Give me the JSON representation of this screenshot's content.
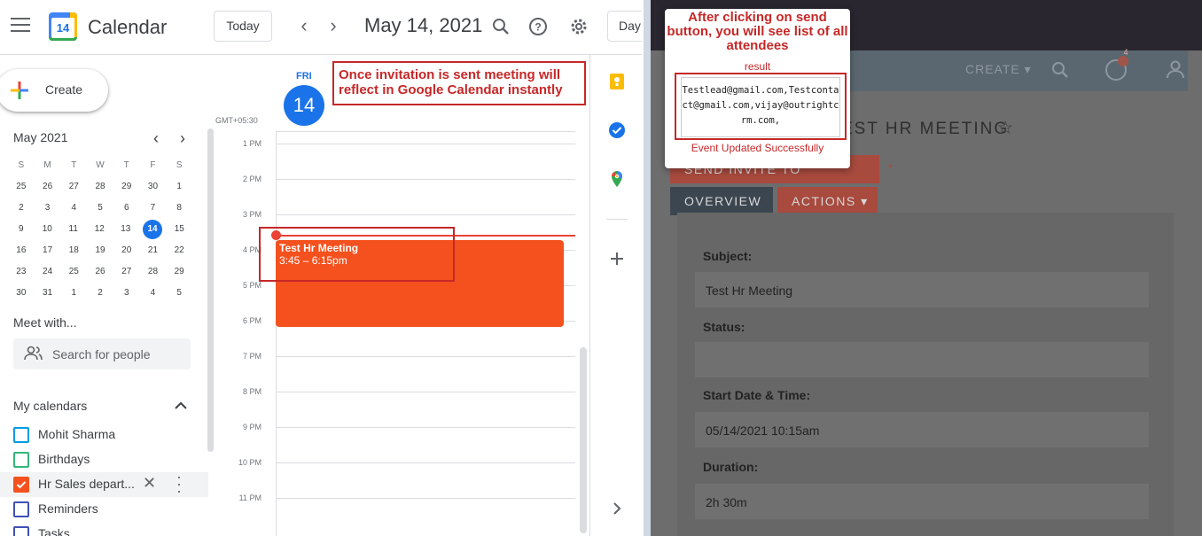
{
  "app": {
    "title": "Calendar",
    "logo_day": "14"
  },
  "toolbar": {
    "today_label": "Today",
    "prev": "‹",
    "next": "›",
    "date_title": "May 14, 2021",
    "view_label": "Day",
    "icons": [
      "search-icon",
      "help-icon",
      "gear-icon"
    ]
  },
  "create": {
    "label": "Create"
  },
  "minical": {
    "title": "May 2021",
    "prev": "‹",
    "next": "›",
    "weekdays": [
      "S",
      "M",
      "T",
      "W",
      "T",
      "F",
      "S"
    ],
    "weeks": [
      [
        "25",
        "26",
        "27",
        "28",
        "29",
        "30",
        "1"
      ],
      [
        "2",
        "3",
        "4",
        "5",
        "6",
        "7",
        "8"
      ],
      [
        "9",
        "10",
        "11",
        "12",
        "13",
        "14",
        "15"
      ],
      [
        "16",
        "17",
        "18",
        "19",
        "20",
        "21",
        "22"
      ],
      [
        "23",
        "24",
        "25",
        "26",
        "27",
        "28",
        "29"
      ],
      [
        "30",
        "31",
        "1",
        "2",
        "3",
        "4",
        "5"
      ]
    ],
    "today": "14"
  },
  "meet": {
    "title": "Meet with...",
    "search_placeholder": "Search for people"
  },
  "my_calendars": {
    "title": "My calendars",
    "items": [
      {
        "label": "Mohit Sharma",
        "color": "#039be5",
        "checked": false
      },
      {
        "label": "Birthdays",
        "color": "#33b679",
        "checked": false
      },
      {
        "label": "Hr Sales depart...",
        "color": "#f4511e",
        "checked": true
      },
      {
        "label": "Reminders",
        "color": "#3f51b5",
        "checked": false
      },
      {
        "label": "Tasks",
        "color": "#3f51b5",
        "checked": false
      }
    ]
  },
  "day": {
    "name": "FRI",
    "number": "14",
    "timezone": "GMT+05:30",
    "hours": [
      "1 PM",
      "2 PM",
      "3 PM",
      "4 PM",
      "5 PM",
      "6 PM",
      "7 PM",
      "8 PM",
      "9 PM",
      "10 PM",
      "11 PM"
    ]
  },
  "event": {
    "title": "Test Hr Meeting",
    "time": "3:45 – 6:15pm",
    "color": "#f4511e"
  },
  "annotation_left": "Once invitation is sent meeting will reflect in Google Calendar instantly",
  "crm": {
    "create_label": "CREATE ▾",
    "notif_count": "4",
    "record_title": "EST HR MEETING",
    "send_invite_label": "SEND INVITE TO EVERYONE",
    "overview_label": "OVERVIEW",
    "actions_label": "ACTIONS ▾",
    "fields": [
      {
        "label": "Subject:",
        "value": "Test Hr Meeting"
      },
      {
        "label": "Status:",
        "value": ""
      },
      {
        "label": "Start Date & Time:",
        "value": "05/14/2021 10:15am"
      },
      {
        "label": "Duration:",
        "value": "2h 30m"
      }
    ]
  },
  "popup": {
    "annotation": "After clicking on send button, you will see list of all attendees",
    "result_label": "result",
    "attendees": "Testlead@gmail.com,Testcontact@gmail.com,vijay@outrightcrm.com,",
    "status": "Event Updated Successfully"
  }
}
